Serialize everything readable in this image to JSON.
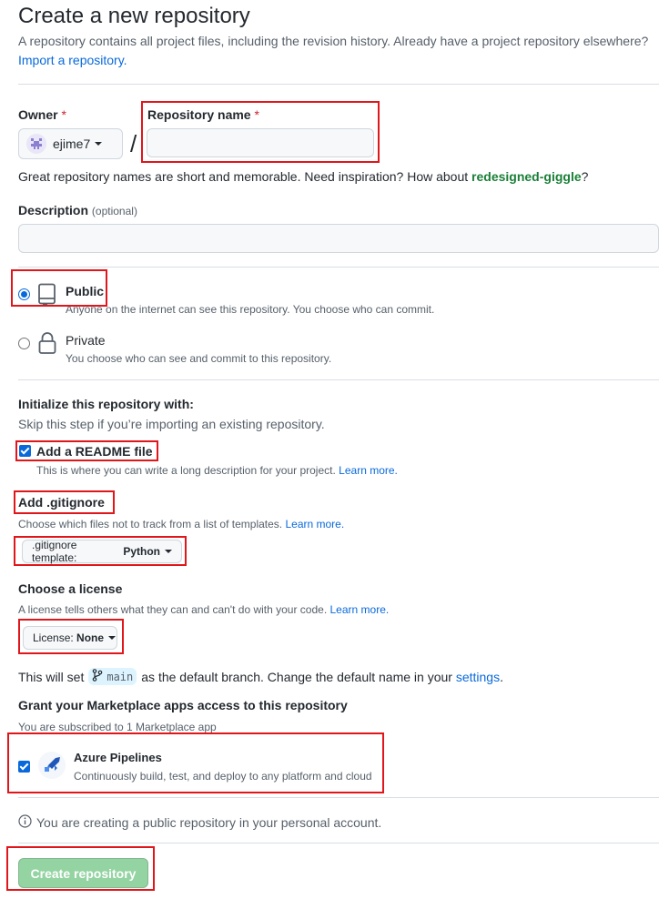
{
  "header": {
    "title": "Create a new repository",
    "description": "A repository contains all project files, including the revision history. Already have a project repository elsewhere?",
    "import_link": "Import a repository."
  },
  "owner": {
    "label": "Owner",
    "required_mark": "*",
    "value": "ejime7",
    "separator": "/"
  },
  "repo_name": {
    "label": "Repository name",
    "required_mark": "*",
    "value": ""
  },
  "name_hint": {
    "prefix": "Great repository names are short and memorable. Need inspiration? How about",
    "suggestion": "redesigned-giggle",
    "suffix": "?"
  },
  "description_field": {
    "label": "Description",
    "optional": "(optional)",
    "value": ""
  },
  "visibility": {
    "selected": "public",
    "public": {
      "title": "Public",
      "desc": "Anyone on the internet can see this repository. You choose who can commit."
    },
    "private": {
      "title": "Private",
      "desc": "You choose who can see and commit to this repository."
    }
  },
  "init": {
    "title": "Initialize this repository with:",
    "subtitle": "Skip this step if you’re importing an existing repository.",
    "readme_label": "Add a README file",
    "readme_checked": true,
    "readme_desc": "This is where you can write a long description for your project.",
    "learn_more": "Learn more."
  },
  "gitignore": {
    "title": "Add .gitignore",
    "desc": "Choose which files not to track from a list of templates.",
    "learn_more": "Learn more.",
    "select_prefix": ".gitignore template:",
    "select_value": "Python"
  },
  "license": {
    "title": "Choose a license",
    "desc": "A license tells others what they can and can't do with your code.",
    "learn_more": "Learn more.",
    "select_prefix": "License:",
    "select_value": "None"
  },
  "branch": {
    "prefix": "This will set",
    "name": "main",
    "middle": "as the default branch. Change the default name in your",
    "settings_link": "settings",
    "suffix": "."
  },
  "marketplace": {
    "title": "Grant your Marketplace apps access to this repository",
    "subtitle": "You are subscribed to 1 Marketplace app",
    "app_name": "Azure Pipelines",
    "app_desc": "Continuously build, test, and deploy to any platform and cloud",
    "app_checked": true
  },
  "notice": "You are creating a public repository in your personal account.",
  "submit": "Create repository",
  "colors": {
    "highlight_box": "#e0161b",
    "submit_disabled": "#94d3a2",
    "link": "#0969da",
    "suggestion": "#1a7f37"
  },
  "icons": [
    "repo-icon",
    "lock-icon",
    "branch-icon",
    "info-icon",
    "azure-pipelines-icon",
    "avatar-identicon"
  ]
}
